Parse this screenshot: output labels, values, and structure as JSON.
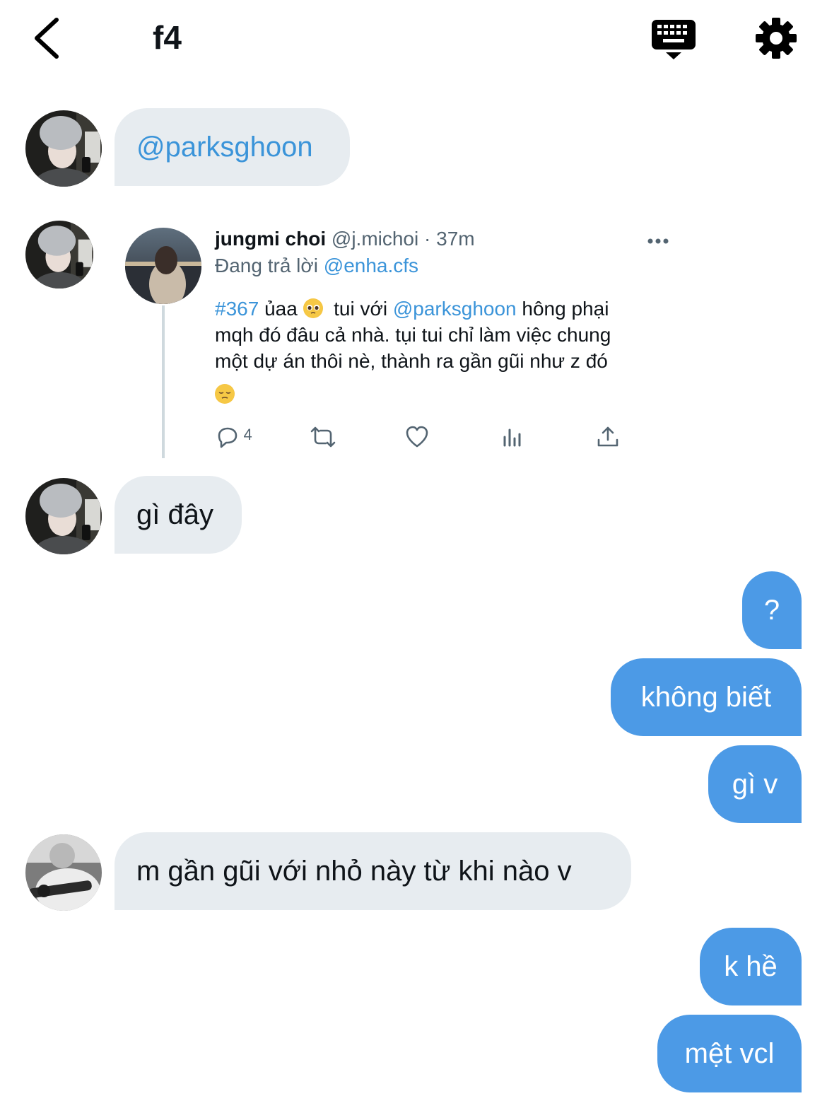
{
  "header": {
    "title": "f4",
    "back_icon": "chevron-left-icon",
    "keyboard_icon": "keyboard-icon",
    "settings_icon": "gear-icon"
  },
  "messages": [
    {
      "side": "in",
      "text": "@parksghoon"
    },
    {
      "side": "in",
      "type": "tweet"
    },
    {
      "side": "in",
      "text": "gì đây"
    },
    {
      "side": "out",
      "text": "?"
    },
    {
      "side": "out",
      "text": "không biết"
    },
    {
      "side": "out",
      "text": "gì v"
    },
    {
      "side": "in",
      "text": "m gần gũi với nhỏ này từ khi nào v"
    },
    {
      "side": "out",
      "text": "k hề"
    },
    {
      "side": "out",
      "text": "mệt vcl"
    }
  ],
  "tweet": {
    "name": "jungmi choi",
    "handle": "@j.michoi",
    "time": "· 37m",
    "reply_prefix": "Đang trả lời",
    "reply_to": "@enha.cfs",
    "hashtag": "#367",
    "text1a": "ủaa",
    "text1b": "tui với",
    "mention": "@parksghoon",
    "text1c": "hông phại",
    "line2": "mqh đó đâu cả nhà. tụi tui chỉ làm việc chung",
    "line3": "một dự án thôi nè, thành ra gần gũi như z đó",
    "reply_count": "4"
  },
  "colors": {
    "accent": "#4c9ae6",
    "mention": "#3b94d9",
    "incoming_bubble": "#e7ecf0"
  }
}
